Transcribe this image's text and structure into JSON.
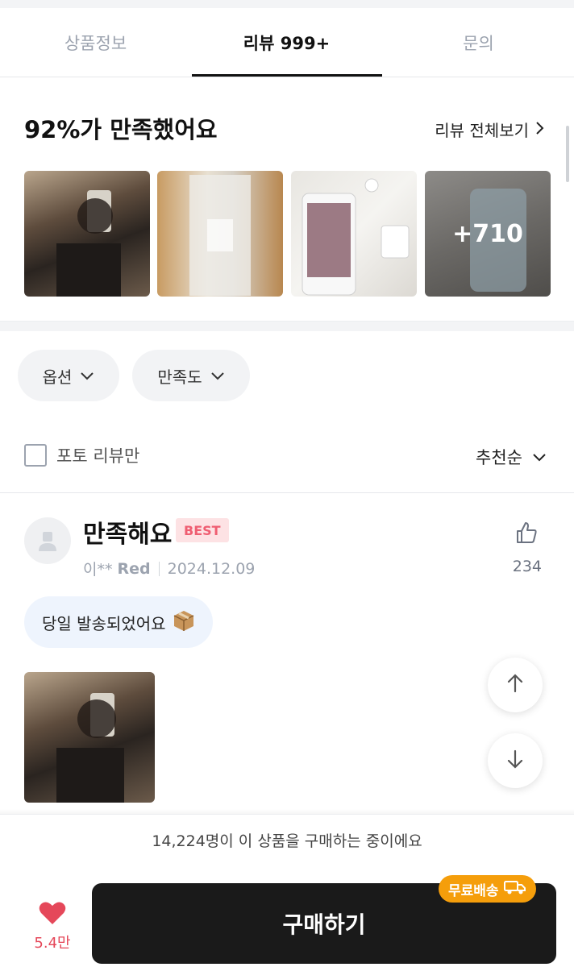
{
  "tabs": [
    {
      "label": "상품정보"
    },
    {
      "label": "리뷰 999+"
    },
    {
      "label": "문의"
    }
  ],
  "summary": {
    "title": "92%가 만족했어요",
    "see_all": "리뷰 전체보기",
    "more_photos": "+710"
  },
  "filters": {
    "option_label": "옵션",
    "satisfaction_label": "만족도",
    "photo_only_label": "포토 리뷰만",
    "sort_label": "추천순"
  },
  "review": {
    "title": "만족해요",
    "badge": "BEST",
    "user": "이**",
    "option": "Red",
    "date": "2024.12.09",
    "likes": "234",
    "shipping_pill": "당일 발송되었어요"
  },
  "bottom": {
    "buying_now": "14,224명이 이 상품을 구매하는 중이에요",
    "wish_count": "5.4만",
    "buy_label": "구매하기",
    "free_shipping": "무료배송"
  },
  "colors": {
    "accent_red": "#e5485a",
    "best_badge_bg": "#fde2e4",
    "free_ship_orange": "#f59e0b",
    "buy_button": "#1a1a1a"
  }
}
